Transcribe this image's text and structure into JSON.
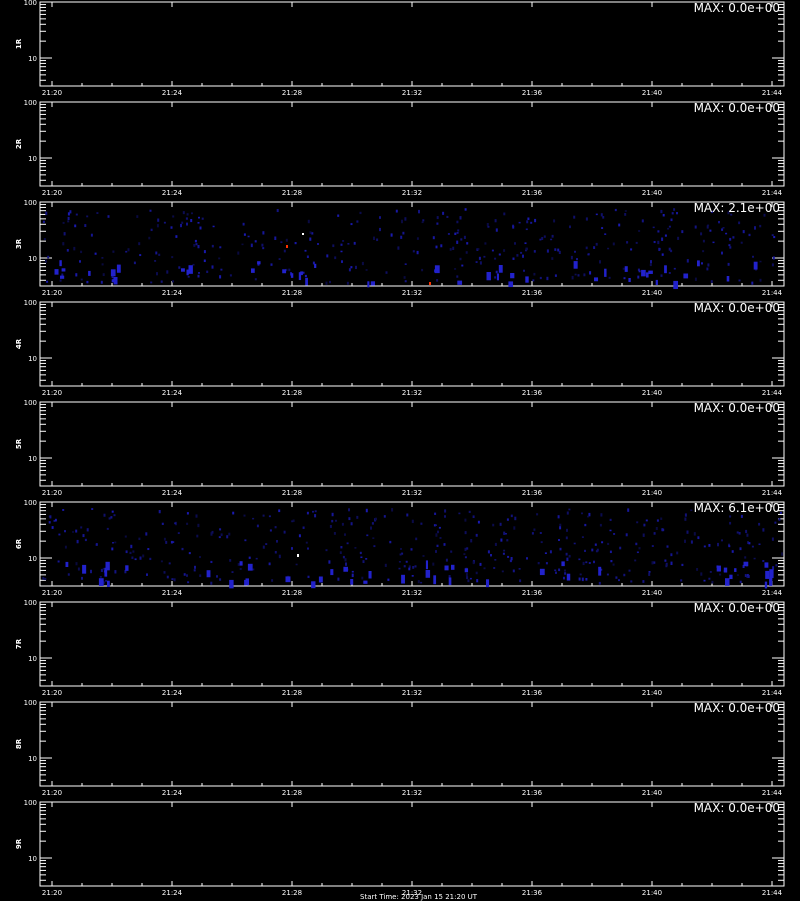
{
  "chart_data": [
    {
      "type": "heatmap",
      "panel_label": "1R",
      "max_label": "MAX: 0.0e+00",
      "activity": "none",
      "y_ticks": [
        "100",
        "10"
      ],
      "x_ticks": [
        "21:20",
        "21:24",
        "21:28",
        "21:32",
        "21:36",
        "21:40",
        "21:44"
      ]
    },
    {
      "type": "heatmap",
      "panel_label": "2R",
      "max_label": "MAX: 0.0e+00",
      "activity": "none",
      "y_ticks": [
        "100",
        "10"
      ],
      "x_ticks": [
        "21:20",
        "21:24",
        "21:28",
        "21:32",
        "21:36",
        "21:40",
        "21:44"
      ]
    },
    {
      "type": "heatmap",
      "panel_label": "3R",
      "max_label": "MAX: 2.1e+00",
      "activity": "sparse",
      "y_ticks": [
        "100",
        "10"
      ],
      "x_ticks": [
        "21:20",
        "21:24",
        "21:28",
        "21:32",
        "21:36",
        "21:40",
        "21:44"
      ]
    },
    {
      "type": "heatmap",
      "panel_label": "4R",
      "max_label": "MAX: 0.0e+00",
      "activity": "none",
      "y_ticks": [
        "100",
        "10"
      ],
      "x_ticks": [
        "21:20",
        "21:24",
        "21:28",
        "21:32",
        "21:36",
        "21:40",
        "21:44"
      ]
    },
    {
      "type": "heatmap",
      "panel_label": "5R",
      "max_label": "MAX: 0.0e+00",
      "activity": "none",
      "y_ticks": [
        "100",
        "10"
      ],
      "x_ticks": [
        "21:20",
        "21:24",
        "21:28",
        "21:32",
        "21:36",
        "21:40",
        "21:44"
      ]
    },
    {
      "type": "heatmap",
      "panel_label": "6R",
      "max_label": "MAX: 6.1e+00",
      "activity": "sparse",
      "y_ticks": [
        "100",
        "10"
      ],
      "x_ticks": [
        "21:20",
        "21:24",
        "21:28",
        "21:32",
        "21:36",
        "21:40",
        "21:44"
      ]
    },
    {
      "type": "heatmap",
      "panel_label": "7R",
      "max_label": "MAX: 0.0e+00",
      "activity": "none",
      "y_ticks": [
        "100",
        "10"
      ],
      "x_ticks": [
        "21:20",
        "21:24",
        "21:28",
        "21:32",
        "21:36",
        "21:40",
        "21:44"
      ]
    },
    {
      "type": "heatmap",
      "panel_label": "8R",
      "max_label": "MAX: 0.0e+00",
      "activity": "none",
      "y_ticks": [
        "100",
        "10"
      ],
      "x_ticks": [
        "21:20",
        "21:24",
        "21:28",
        "21:32",
        "21:36",
        "21:40",
        "21:44"
      ]
    },
    {
      "type": "heatmap",
      "panel_label": "9R",
      "max_label": "MAX: 0.0e+00",
      "activity": "none",
      "y_ticks": [
        "100",
        "10"
      ],
      "x_ticks": [
        "21:20",
        "21:24",
        "21:28",
        "21:32",
        "21:36",
        "21:40",
        "21:44"
      ]
    }
  ],
  "colors": {
    "background": "#000000",
    "axes": "#ffffff",
    "low": "#2222cc",
    "high": "#ff3300",
    "peak": "#ffffff"
  },
  "footer": "Start Time: 2023 Jan 15 21:20 UT"
}
